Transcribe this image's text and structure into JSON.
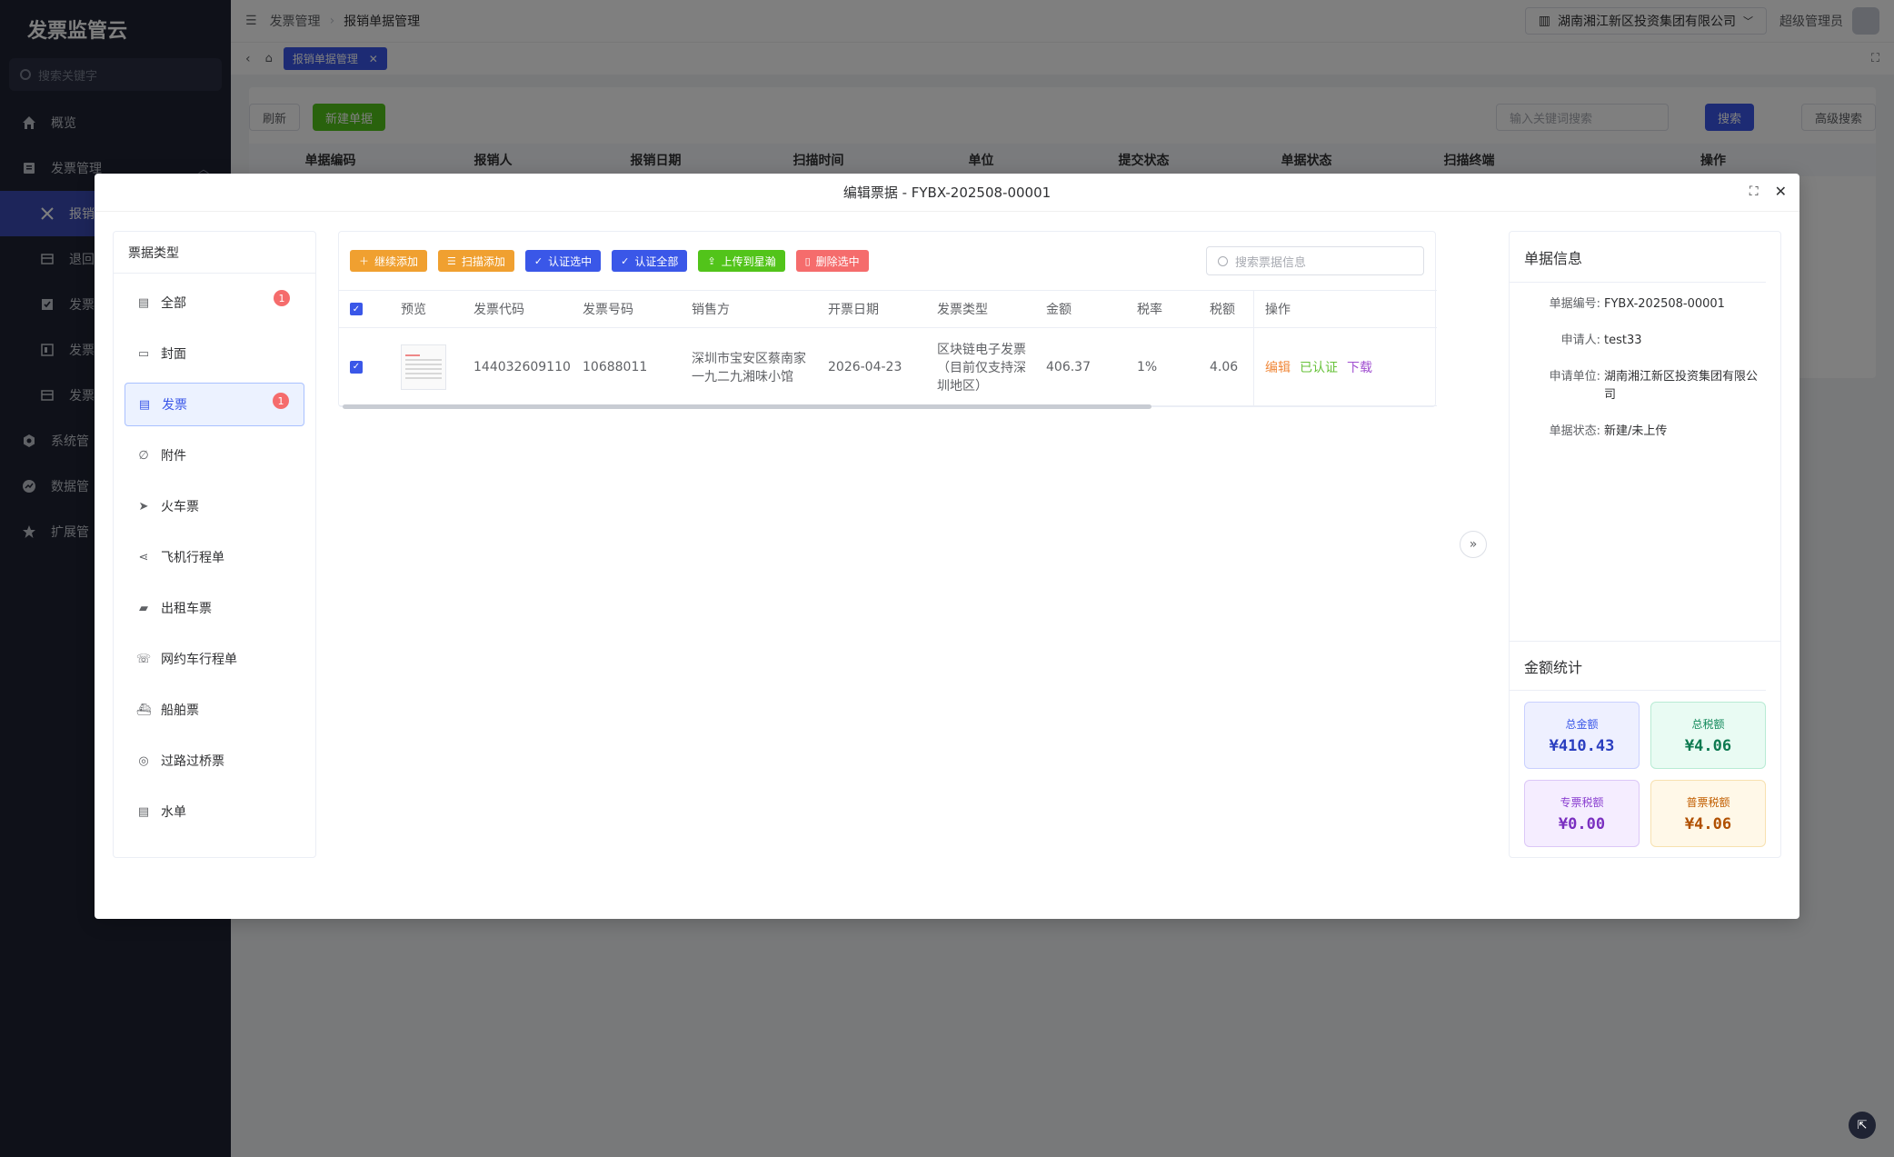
{
  "app": {
    "title": "发票监管云"
  },
  "sidebar": {
    "search_placeholder": "搜索关键字",
    "items": [
      {
        "label": "概览",
        "icon": "home-icon"
      },
      {
        "label": "发票管理",
        "icon": "invoice-icon"
      },
      {
        "label": "报销",
        "icon": "tools-icon"
      },
      {
        "label": "退回",
        "icon": "box-icon"
      },
      {
        "label": "发票",
        "icon": "check-icon"
      },
      {
        "label": "发票",
        "icon": "doc-icon"
      },
      {
        "label": "发票",
        "icon": "box-icon"
      },
      {
        "label": "系统管",
        "icon": "gear-icon"
      },
      {
        "label": "数据管",
        "icon": "chart-icon"
      },
      {
        "label": "扩展管",
        "icon": "star-icon"
      }
    ]
  },
  "topbar": {
    "breadcrumb": [
      "发票管理",
      "报销单据管理"
    ],
    "company": "湖南湘江新区投资集团有限公司",
    "user": "超级管理员"
  },
  "tabs": {
    "active": "报销单据管理"
  },
  "background": {
    "refresh": "刷新",
    "new": "新建单据",
    "search_placeholder": "输入关键词搜索",
    "search": "搜索",
    "advanced": "高级搜索",
    "columns": [
      "单据编码",
      "报销人",
      "报销日期",
      "扫描时间",
      "单位",
      "提交状态",
      "单据状态",
      "扫描终端",
      "操作"
    ]
  },
  "modal": {
    "title": "编辑票据 - FYBX-202508-00001",
    "types_title": "票据类型",
    "types": [
      {
        "label": "全部",
        "icon": "doc-icon",
        "badge": "1"
      },
      {
        "label": "封面",
        "icon": "folder-icon",
        "badge": ""
      },
      {
        "label": "发票",
        "icon": "doc-icon",
        "badge": "1"
      },
      {
        "label": "附件",
        "icon": "paperclip-icon",
        "badge": ""
      },
      {
        "label": "火车票",
        "icon": "send-icon",
        "badge": ""
      },
      {
        "label": "飞机行程单",
        "icon": "share-icon",
        "badge": ""
      },
      {
        "label": "出租车票",
        "icon": "truck-icon",
        "badge": ""
      },
      {
        "label": "网约车行程单",
        "icon": "phone-icon",
        "badge": ""
      },
      {
        "label": "船舶票",
        "icon": "ship-icon",
        "badge": ""
      },
      {
        "label": "过路过桥票",
        "icon": "location-icon",
        "badge": ""
      },
      {
        "label": "水单",
        "icon": "doc-icon",
        "badge": ""
      }
    ],
    "toolbar": {
      "continue_add": "继续添加",
      "scan_add": "扫描添加",
      "verify_selected": "认证选中",
      "verify_all": "认证全部",
      "upload": "上传到星瀚",
      "delete_selected": "删除选中",
      "search_placeholder": "搜索票据信息"
    },
    "columns": [
      "预览",
      "发票代码",
      "发票号码",
      "销售方",
      "开票日期",
      "发票类型",
      "金额",
      "税率",
      "税额",
      "操作"
    ],
    "rows": [
      {
        "code": "144032609110",
        "number": "10688011",
        "seller": "深圳市宝安区蔡南家一九二九湘味小馆",
        "date": "2026-04-23",
        "type": "区块链电子发票（目前仅支持深圳地区）",
        "amount": "406.37",
        "rate": "1%",
        "tax": "4.06",
        "op_edit": "编辑",
        "op_verified": "已认证",
        "op_download": "下载"
      }
    ],
    "info": {
      "title": "单据信息",
      "fields": [
        {
          "label": "单据编号:",
          "value": "FYBX-202508-00001"
        },
        {
          "label": "申请人:",
          "value": "test33"
        },
        {
          "label": "申请单位:",
          "value": "湖南湘江新区投资集团有限公司"
        },
        {
          "label": "单据状态:",
          "value": "新建/未上传"
        }
      ]
    },
    "stats": {
      "title": "金额统计",
      "items": [
        {
          "label": "总金额",
          "value": "¥410.43"
        },
        {
          "label": "总税额",
          "value": "¥4.06"
        },
        {
          "label": "专票税额",
          "value": "¥0.00"
        },
        {
          "label": "普票税额",
          "value": "¥4.06"
        }
      ]
    }
  }
}
